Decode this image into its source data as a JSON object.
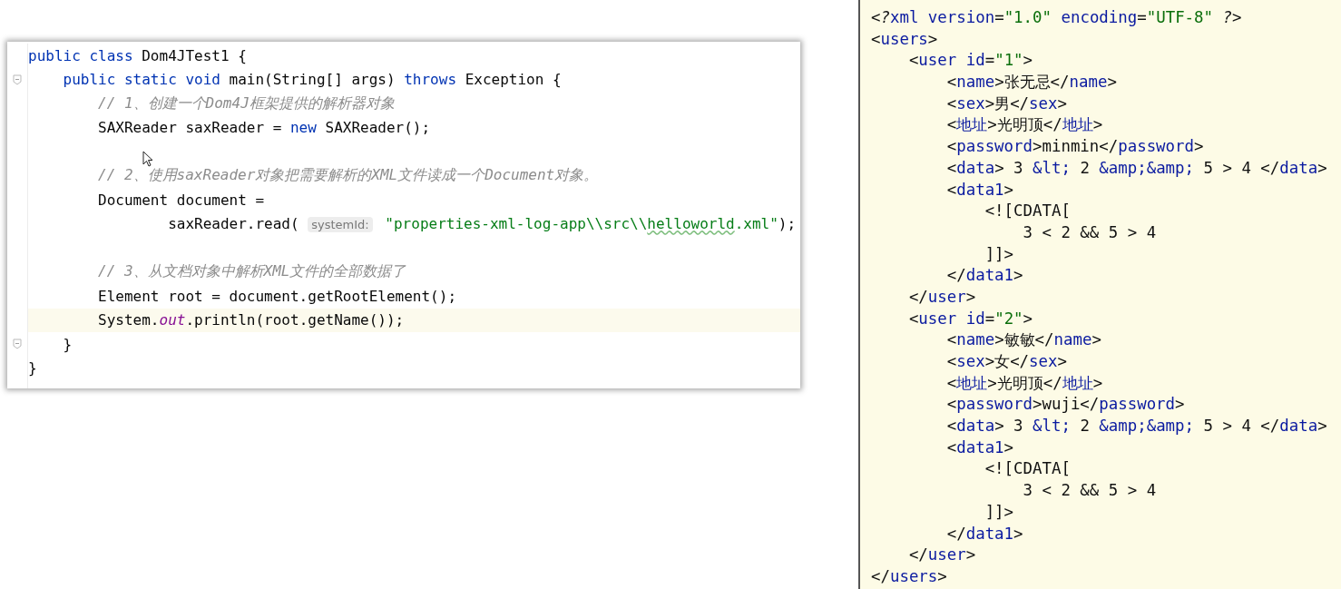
{
  "editor": {
    "lines": [
      {
        "kind": "code",
        "current": false,
        "foldable": false,
        "tokens": [
          {
            "kind": "keyword",
            "text": "public class"
          },
          {
            "kind": "plain",
            "text": " Dom4JTest1 {"
          }
        ]
      },
      {
        "kind": "code",
        "current": false,
        "foldable": true,
        "tokens": [
          {
            "kind": "keyword",
            "text": "    public static void"
          },
          {
            "kind": "plain",
            "text": " main(String[] args) "
          },
          {
            "kind": "keyword",
            "text": "throws"
          },
          {
            "kind": "plain",
            "text": " Exception {"
          }
        ]
      },
      {
        "kind": "code",
        "current": false,
        "foldable": false,
        "tokens": [
          {
            "kind": "comment",
            "text": "        // 1、创建一个Dom4J框架提供的解析器对象"
          }
        ]
      },
      {
        "kind": "code",
        "current": false,
        "foldable": false,
        "tokens": [
          {
            "kind": "plain",
            "text": "        SAXReader saxReader = "
          },
          {
            "kind": "keyword",
            "text": "new"
          },
          {
            "kind": "plain",
            "text": " SAXReader();"
          }
        ]
      },
      {
        "kind": "blank",
        "current": false,
        "foldable": false
      },
      {
        "kind": "code",
        "current": false,
        "foldable": false,
        "tokens": [
          {
            "kind": "comment",
            "text": "        // 2、使用saxReader对象把需要解析的XML文件读成一个Document对象。"
          }
        ]
      },
      {
        "kind": "code",
        "current": false,
        "foldable": false,
        "tokens": [
          {
            "kind": "plain",
            "text": "        Document document ="
          }
        ]
      },
      {
        "kind": "code",
        "current": false,
        "foldable": false,
        "tokens": [
          {
            "kind": "plain",
            "text": "                saxReader.read( "
          },
          {
            "kind": "hint",
            "text": "systemId:"
          },
          {
            "kind": "string",
            "text": " \"properties-xml-log-app\\\\src\\\\"
          },
          {
            "kind": "typo",
            "text": "helloworld"
          },
          {
            "kind": "string",
            "text": ".xml\""
          },
          {
            "kind": "plain",
            "text": ");"
          }
        ]
      },
      {
        "kind": "blank",
        "current": false,
        "foldable": false
      },
      {
        "kind": "code",
        "current": false,
        "foldable": false,
        "tokens": [
          {
            "kind": "comment",
            "text": "        // 3、从文档对象中解析XML文件的全部数据了"
          }
        ]
      },
      {
        "kind": "code",
        "current": false,
        "foldable": false,
        "tokens": [
          {
            "kind": "plain",
            "text": "        Element root = document.getRootElement();"
          }
        ]
      },
      {
        "kind": "code",
        "current": true,
        "foldable": false,
        "tokens": [
          {
            "kind": "plain",
            "text": "        System."
          },
          {
            "kind": "field",
            "text": "out"
          },
          {
            "kind": "plain",
            "text": ".println(root.getName());"
          }
        ]
      },
      {
        "kind": "code",
        "current": false,
        "foldable": true,
        "tokens": [
          {
            "kind": "plain",
            "text": "    }"
          }
        ]
      },
      {
        "kind": "code",
        "current": false,
        "foldable": false,
        "tokens": [
          {
            "kind": "plain",
            "text": "}"
          }
        ]
      }
    ]
  },
  "xml_viewer": {
    "lines": [
      {
        "tokens": [
          {
            "kind": "plain",
            "text": "<"
          },
          {
            "kind": "pi",
            "text": "?"
          },
          {
            "kind": "tag",
            "text": "xml"
          },
          {
            "kind": "attr",
            "text": " version"
          },
          {
            "kind": "plain",
            "text": "="
          },
          {
            "kind": "value",
            "text": "\"1.0\""
          },
          {
            "kind": "attr",
            "text": " encoding"
          },
          {
            "kind": "plain",
            "text": "="
          },
          {
            "kind": "value",
            "text": "\"UTF-8\""
          },
          {
            "kind": "pi",
            "text": " ?"
          },
          {
            "kind": "plain",
            "text": ">"
          }
        ]
      },
      {
        "tokens": [
          {
            "kind": "plain",
            "text": "<"
          },
          {
            "kind": "tag",
            "text": "users"
          },
          {
            "kind": "plain",
            "text": ">"
          }
        ]
      },
      {
        "tokens": [
          {
            "kind": "plain",
            "text": "    <"
          },
          {
            "kind": "tag",
            "text": "user"
          },
          {
            "kind": "attr",
            "text": " id"
          },
          {
            "kind": "plain",
            "text": "="
          },
          {
            "kind": "value",
            "text": "\"1\""
          },
          {
            "kind": "plain",
            "text": ">"
          }
        ]
      },
      {
        "tokens": [
          {
            "kind": "plain",
            "text": "        <"
          },
          {
            "kind": "tag",
            "text": "name"
          },
          {
            "kind": "plain",
            "text": ">张无忌</"
          },
          {
            "kind": "tag",
            "text": "name"
          },
          {
            "kind": "plain",
            "text": ">"
          }
        ]
      },
      {
        "tokens": [
          {
            "kind": "plain",
            "text": "        <"
          },
          {
            "kind": "tag",
            "text": "sex"
          },
          {
            "kind": "plain",
            "text": ">男</"
          },
          {
            "kind": "tag",
            "text": "sex"
          },
          {
            "kind": "plain",
            "text": ">"
          }
        ]
      },
      {
        "tokens": [
          {
            "kind": "plain",
            "text": "        <"
          },
          {
            "kind": "tag",
            "text": "地址"
          },
          {
            "kind": "plain",
            "text": ">光明顶</"
          },
          {
            "kind": "tag",
            "text": "地址"
          },
          {
            "kind": "plain",
            "text": ">"
          }
        ]
      },
      {
        "tokens": [
          {
            "kind": "plain",
            "text": "        <"
          },
          {
            "kind": "tag",
            "text": "password"
          },
          {
            "kind": "plain",
            "text": ">minmin</"
          },
          {
            "kind": "tag",
            "text": "password"
          },
          {
            "kind": "plain",
            "text": ">"
          }
        ]
      },
      {
        "tokens": [
          {
            "kind": "plain",
            "text": "        <"
          },
          {
            "kind": "tag",
            "text": "data"
          },
          {
            "kind": "plain",
            "text": "> 3 "
          },
          {
            "kind": "entity",
            "text": "&lt;"
          },
          {
            "kind": "plain",
            "text": " 2 "
          },
          {
            "kind": "entity",
            "text": "&amp;&amp;"
          },
          {
            "kind": "plain",
            "text": " 5 > 4 </"
          },
          {
            "kind": "tag",
            "text": "data"
          },
          {
            "kind": "plain",
            "text": ">"
          }
        ]
      },
      {
        "tokens": [
          {
            "kind": "plain",
            "text": "        <"
          },
          {
            "kind": "tag",
            "text": "data1"
          },
          {
            "kind": "plain",
            "text": ">"
          }
        ]
      },
      {
        "tokens": [
          {
            "kind": "plain",
            "text": "            <![CDATA["
          }
        ]
      },
      {
        "tokens": [
          {
            "kind": "plain",
            "text": "                3 < 2 && 5 > 4"
          }
        ]
      },
      {
        "tokens": [
          {
            "kind": "plain",
            "text": "            ]]>"
          }
        ]
      },
      {
        "tokens": [
          {
            "kind": "plain",
            "text": "        </"
          },
          {
            "kind": "tag",
            "text": "data1"
          },
          {
            "kind": "plain",
            "text": ">"
          }
        ]
      },
      {
        "tokens": [
          {
            "kind": "plain",
            "text": "    </"
          },
          {
            "kind": "tag",
            "text": "user"
          },
          {
            "kind": "plain",
            "text": ">"
          }
        ]
      },
      {
        "tokens": [
          {
            "kind": "plain",
            "text": "    <"
          },
          {
            "kind": "tag",
            "text": "user"
          },
          {
            "kind": "attr",
            "text": " id"
          },
          {
            "kind": "plain",
            "text": "="
          },
          {
            "kind": "value",
            "text": "\"2\""
          },
          {
            "kind": "plain",
            "text": ">"
          }
        ]
      },
      {
        "tokens": [
          {
            "kind": "plain",
            "text": "        <"
          },
          {
            "kind": "tag",
            "text": "name"
          },
          {
            "kind": "plain",
            "text": ">敏敏</"
          },
          {
            "kind": "tag",
            "text": "name"
          },
          {
            "kind": "plain",
            "text": ">"
          }
        ]
      },
      {
        "tokens": [
          {
            "kind": "plain",
            "text": "        <"
          },
          {
            "kind": "tag",
            "text": "sex"
          },
          {
            "kind": "plain",
            "text": ">女</"
          },
          {
            "kind": "tag",
            "text": "sex"
          },
          {
            "kind": "plain",
            "text": ">"
          }
        ]
      },
      {
        "tokens": [
          {
            "kind": "plain",
            "text": "        <"
          },
          {
            "kind": "tag",
            "text": "地址"
          },
          {
            "kind": "plain",
            "text": ">光明顶</"
          },
          {
            "kind": "tag",
            "text": "地址"
          },
          {
            "kind": "plain",
            "text": ">"
          }
        ]
      },
      {
        "tokens": [
          {
            "kind": "plain",
            "text": "        <"
          },
          {
            "kind": "tag",
            "text": "password"
          },
          {
            "kind": "plain",
            "text": ">wuji</"
          },
          {
            "kind": "tag",
            "text": "password"
          },
          {
            "kind": "plain",
            "text": ">"
          }
        ]
      },
      {
        "tokens": [
          {
            "kind": "plain",
            "text": "        <"
          },
          {
            "kind": "tag",
            "text": "data"
          },
          {
            "kind": "plain",
            "text": "> 3 "
          },
          {
            "kind": "entity",
            "text": "&lt;"
          },
          {
            "kind": "plain",
            "text": " 2 "
          },
          {
            "kind": "entity",
            "text": "&amp;&amp;"
          },
          {
            "kind": "plain",
            "text": " 5 > 4 </"
          },
          {
            "kind": "tag",
            "text": "data"
          },
          {
            "kind": "plain",
            "text": ">"
          }
        ]
      },
      {
        "tokens": [
          {
            "kind": "plain",
            "text": "        <"
          },
          {
            "kind": "tag",
            "text": "data1"
          },
          {
            "kind": "plain",
            "text": ">"
          }
        ]
      },
      {
        "tokens": [
          {
            "kind": "plain",
            "text": "            <![CDATA["
          }
        ]
      },
      {
        "tokens": [
          {
            "kind": "plain",
            "text": "                3 < 2 && 5 > 4"
          }
        ]
      },
      {
        "tokens": [
          {
            "kind": "plain",
            "text": "            ]]>"
          }
        ]
      },
      {
        "tokens": [
          {
            "kind": "plain",
            "text": "        </"
          },
          {
            "kind": "tag",
            "text": "data1"
          },
          {
            "kind": "plain",
            "text": ">"
          }
        ]
      },
      {
        "tokens": [
          {
            "kind": "plain",
            "text": "    </"
          },
          {
            "kind": "tag",
            "text": "user"
          },
          {
            "kind": "plain",
            "text": ">"
          }
        ]
      },
      {
        "tokens": [
          {
            "kind": "plain",
            "text": "</"
          },
          {
            "kind": "tag",
            "text": "users"
          },
          {
            "kind": "plain",
            "text": ">"
          }
        ]
      }
    ]
  }
}
